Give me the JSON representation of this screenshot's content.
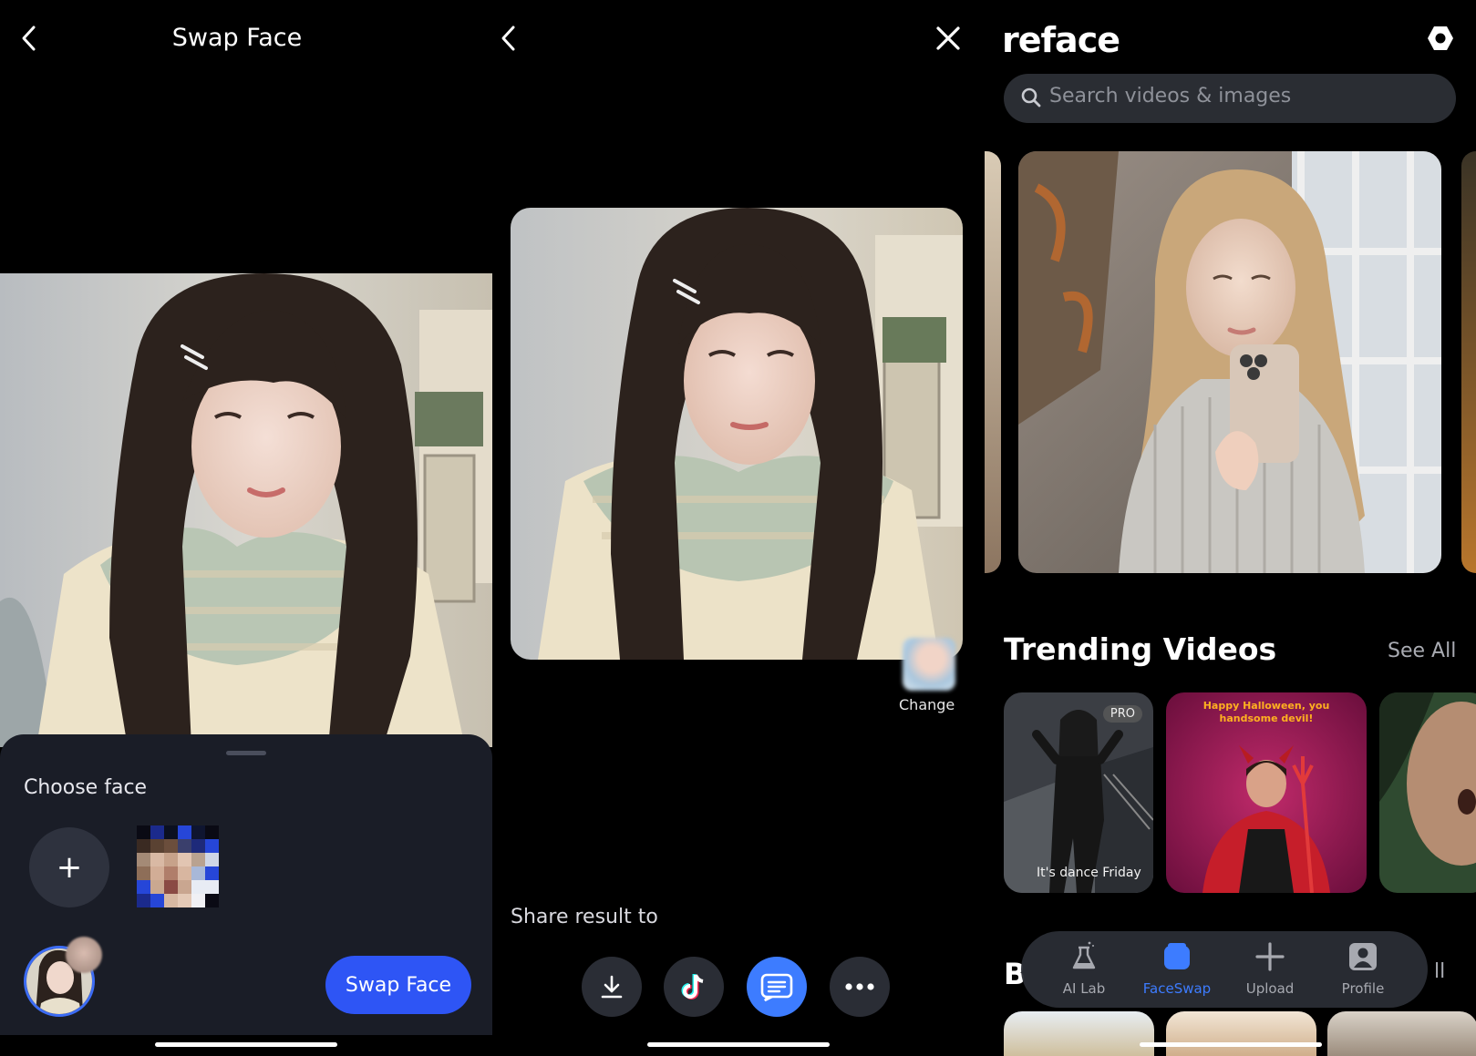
{
  "panel1": {
    "title": "Swap Face",
    "choose_face_label": "Choose face",
    "add_face_label": "+",
    "swap_button_label": "Swap Face"
  },
  "panel2": {
    "change_label": "Change",
    "share_label": "Share result to",
    "share_targets": [
      "download-icon",
      "tiktok-icon",
      "messages-icon",
      "more-icon"
    ]
  },
  "panel3": {
    "logo": "reface",
    "search_placeholder": "Search videos & images",
    "trending_title": "Trending Videos",
    "see_all": "See All",
    "trending_items": [
      {
        "badge": "PRO",
        "caption": "It's dance Friday"
      },
      {
        "badge": "",
        "caption": "Happy Halloween, you handsome devil!"
      },
      {
        "badge": "",
        "caption": ""
      }
    ],
    "next_section_title": "B",
    "next_section_see_all": "ll",
    "tabs": [
      {
        "label": "AI Lab",
        "icon": "flask-icon",
        "active": false
      },
      {
        "label": "FaceSwap",
        "icon": "faceswap-icon",
        "active": true
      },
      {
        "label": "Upload",
        "icon": "plus-icon",
        "active": false
      },
      {
        "label": "Profile",
        "icon": "profile-icon",
        "active": false
      }
    ]
  },
  "colors": {
    "accent": "#2e55f5",
    "sheet": "#1a1d27",
    "active_tab": "#3d7cff"
  }
}
